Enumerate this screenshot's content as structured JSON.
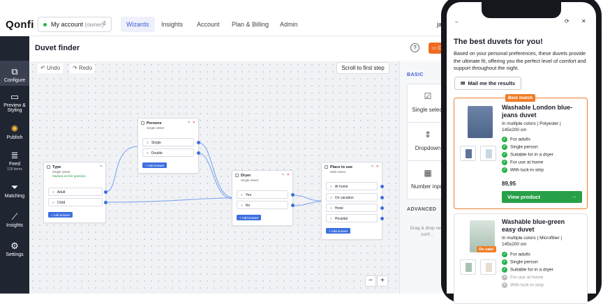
{
  "app": {
    "logo": "Qonfi",
    "account_name": "My account",
    "account_role": "(owner)",
    "user_initials": "ja"
  },
  "nav": [
    "Wizards",
    "Insights",
    "Account",
    "Plan & Billing",
    "Admin"
  ],
  "sidebar": [
    {
      "label": "Configure",
      "icon": "configure-icon",
      "glyph": "⧉"
    },
    {
      "label": "Preview & Styling",
      "icon": "monitor-icon",
      "glyph": "▭"
    },
    {
      "label": "Publish",
      "icon": "party-icon",
      "glyph": "✺"
    },
    {
      "label": "Feed",
      "sub": "128 items",
      "icon": "database-icon",
      "glyph": "≣"
    },
    {
      "label": "Matching",
      "icon": "funnel-icon",
      "glyph": "⏷"
    },
    {
      "label": "Insights",
      "icon": "chart-icon",
      "glyph": "⟋"
    },
    {
      "label": "Settings",
      "icon": "gear-icon",
      "glyph": "⚙"
    }
  ],
  "editor": {
    "title": "Duvet finder",
    "undo": "Undo",
    "redo": "Redo",
    "scroll_first": "Scroll to first step",
    "zoom_out": "−",
    "zoom_in": "+"
  },
  "nodes": [
    {
      "id": "type",
      "title": "Type",
      "subtitle": "Single select",
      "marked": "Marked as first question.",
      "options": [
        "Adult",
        "Child"
      ],
      "add": "+ Add answer"
    },
    {
      "id": "persons",
      "title": "Persons",
      "subtitle": "Single select",
      "options": [
        "Single",
        "Double"
      ],
      "add": "+ Add answer"
    },
    {
      "id": "dryer",
      "title": "Dryer",
      "subtitle": "Single select",
      "options": [
        "Yes",
        "No"
      ],
      "add": "+ Add answer"
    },
    {
      "id": "place",
      "title": "Place to use",
      "subtitle": "Multi select",
      "options": [
        "At home",
        "On vacation",
        "Hotel",
        "Hospital"
      ],
      "add": "+ Add answer"
    }
  ],
  "panel": {
    "basic": "BASIC",
    "cards": [
      {
        "label": "Single select",
        "glyph": "☑",
        "icon": "checkbox-icon"
      },
      {
        "label": "Dropdown",
        "glyph": "⇕",
        "icon": "dropdown-icon"
      },
      {
        "label": "Number input",
        "glyph": "▦",
        "icon": "calculator-icon"
      }
    ],
    "advanced": "ADVANCED",
    "note": "Drag & drop new conf..."
  },
  "phone": {
    "title": "The best duvets for you!",
    "desc": "Based on your personal preferences, these duvets provide the ultimate fit, offering you the perfect level of comfort and support throughout the night.",
    "mail": "Mail me the results",
    "best_badge": "Best match",
    "products": [
      {
        "name": "Washable London blue-jeans duvet",
        "attrs": "In multiple colors | Polyester | 145x200 cm",
        "features": [
          {
            "t": "For adults",
            "ok": true
          },
          {
            "t": "Single person",
            "ok": true
          },
          {
            "t": "Suitable for in a dryer",
            "ok": true
          },
          {
            "t": "For use at home",
            "ok": true
          },
          {
            "t": "With tuck-in strip",
            "ok": true
          }
        ],
        "price": "89,95",
        "cta": "View product"
      },
      {
        "name": "Washable blue-green easy duvet",
        "attrs": "In multiple colors | Microfiber | 145x200 cm",
        "sale": "On sale!",
        "features": [
          {
            "t": "For adults",
            "ok": true
          },
          {
            "t": "Single person",
            "ok": true
          },
          {
            "t": "Suitable for in a dryer",
            "ok": true
          },
          {
            "t": "For use at home",
            "ok": false
          },
          {
            "t": "With tuck-in strip",
            "ok": false
          }
        ]
      }
    ]
  },
  "colors": {
    "accent": "#3d6fe0",
    "orange": "#ef7d27",
    "green": "#27a048",
    "sidebar": "#202532"
  }
}
